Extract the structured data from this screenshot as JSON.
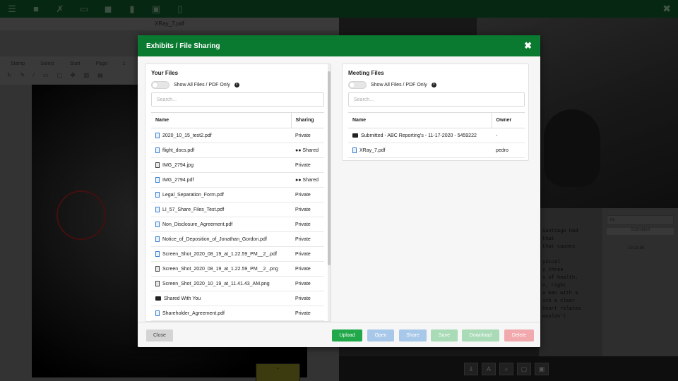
{
  "background": {
    "doc_tab_title": "XRay_7.pdf",
    "doc_toolbar_labels": [
      "Stamp",
      "Select",
      "Start",
      "Page"
    ],
    "page_number": "1",
    "transcript_lines": [
      "Santiago had",
      "that",
      "that causes",
      "",
      "ysical",
      "y three",
      "s of health.",
      "n, right",
      "a man with a",
      "ith a clear",
      "heart relates",
      "wouldn't"
    ],
    "side_search_text": "be",
    "side_button_label": "Submitted",
    "side_time": "10:13:56"
  },
  "modal": {
    "title": "Exhibits / File Sharing",
    "close_symbol": "✖",
    "your_files": {
      "title": "Your Files",
      "toggle_label": "Show All Files / PDF Only",
      "info_symbol": "i",
      "search_placeholder": "Search...",
      "col_name": "Name",
      "col_sharing": "Sharing",
      "rows": [
        {
          "name": "2020_10_15_test2.pdf",
          "sharing": "Private",
          "icon": "pdf-icon"
        },
        {
          "name": "flight_docs.pdf",
          "sharing": "Shared",
          "icon": "pdf-icon"
        },
        {
          "name": "IMG_2794.jpg",
          "sharing": "Private",
          "icon": "image-file-icon"
        },
        {
          "name": "IMG_2794.pdf",
          "sharing": "Shared",
          "icon": "pdf-icon"
        },
        {
          "name": "Legal_Separation_Form.pdf",
          "sharing": "Private",
          "icon": "pdf-icon"
        },
        {
          "name": "LI_57_Share_Files_Test.pdf",
          "sharing": "Private",
          "icon": "pdf-icon"
        },
        {
          "name": "Non_Disclosure_Agreement.pdf",
          "sharing": "Private",
          "icon": "pdf-icon"
        },
        {
          "name": "Notice_of_Deposition_of_Jonathan_Gordon.pdf",
          "sharing": "Private",
          "icon": "pdf-icon"
        },
        {
          "name": "Screen_Shot_2020_08_19_at_1.22.59_PM__2_.pdf",
          "sharing": "Private",
          "icon": "pdf-icon"
        },
        {
          "name": "Screen_Shot_2020_08_19_at_1.22.59_PM__2_.png",
          "sharing": "Private",
          "icon": "image-file-icon"
        },
        {
          "name": "Screen_Shot_2020_10_19_at_11.41.43_AM.png",
          "sharing": "Private",
          "icon": "image-file-icon"
        },
        {
          "name": "Shared With You",
          "sharing": "Private",
          "icon": "folder-icon"
        },
        {
          "name": "Shareholder_Agreement.pdf",
          "sharing": "Private",
          "icon": "pdf-icon"
        }
      ]
    },
    "meeting_files": {
      "title": "Meeting Files",
      "toggle_label": "Show All Files / PDF Only",
      "info_symbol": "i",
      "search_placeholder": "Search...",
      "col_name": "Name",
      "col_owner": "Owner",
      "rows": [
        {
          "name": "Submitted - ABC Reporting's - 11-17-2020 - 5459222",
          "owner": "-",
          "icon": "folder-icon"
        },
        {
          "name": "XRay_7.pdf",
          "owner": "pedro",
          "icon": "pdf-icon"
        }
      ]
    },
    "footer": {
      "close_label": "Close",
      "upload_label": "Upload",
      "open_label": "Open",
      "share_label": "Share",
      "save_label": "Save",
      "download_label": "Download",
      "delete_label": "Delete"
    },
    "colors": {
      "header_green": "#0a7a30",
      "upload_green": "#21a84a",
      "open_blue": "#a8c8ea",
      "share_blue": "#a8c8ea",
      "save_green": "#a9dbb7",
      "download_green": "#a9dbb7",
      "delete_red": "#f2a9ad",
      "close_gray": "#d4d4d4"
    }
  }
}
